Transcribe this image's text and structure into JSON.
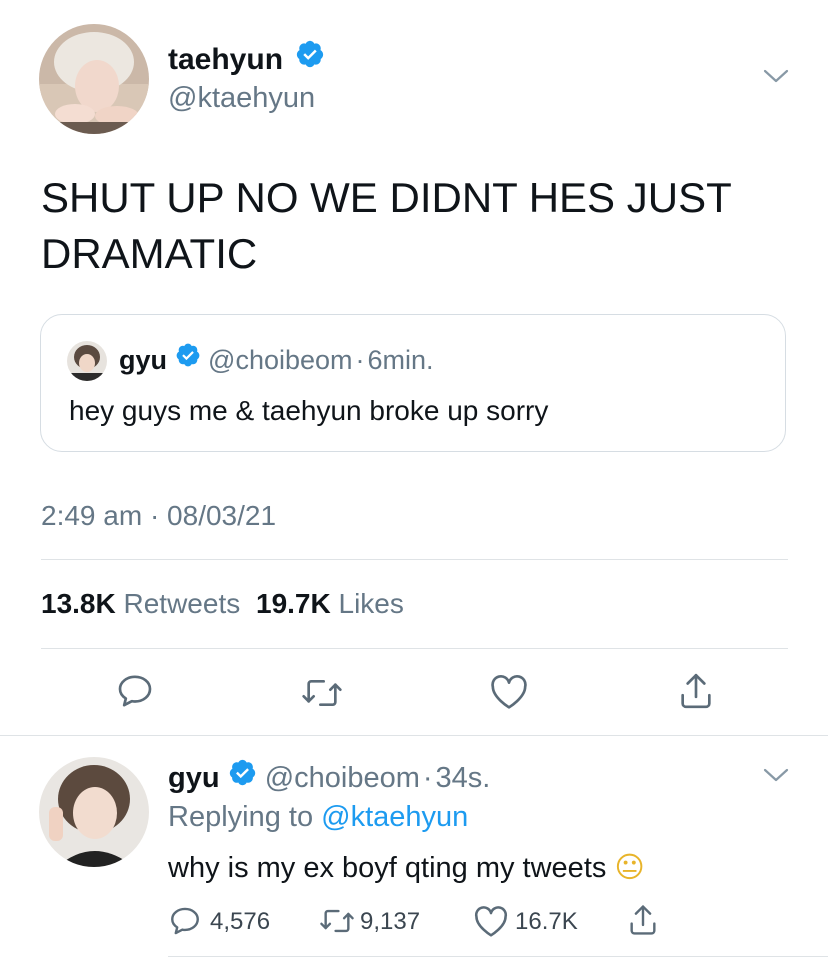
{
  "main_tweet": {
    "display_name": "taehyun",
    "handle": "@ktaehyun",
    "text_line1": "SHUT UP NO WE DIDNT HES JUST",
    "text_line2": "DRAMATIC",
    "quoted": {
      "display_name": "gyu",
      "handle": "@choibeom",
      "sep": "·",
      "time": "6min.",
      "text": "hey guys me & taehyun broke up sorry"
    },
    "timestamp": "2:49 am · 08/03/21",
    "retweets_count": "13.8K",
    "retweets_label": "Retweets",
    "likes_count": "19.7K",
    "likes_label": "Likes"
  },
  "reply": {
    "display_name": "gyu",
    "handle": "@choibeom",
    "sep": "·",
    "time": "34s.",
    "replying_to_label": "Replying to",
    "replying_to_handle": "@ktaehyun",
    "text": "why is my ex boyf qting my tweets",
    "emoji": "😐",
    "reply_count": "4,576",
    "retweet_count": "9,137",
    "like_count": "16.7K"
  },
  "colors": {
    "accent": "#1d9bf0",
    "secondary_text": "#657786",
    "divider": "#dfe3e6"
  },
  "icons": [
    "verified-badge-icon",
    "chevron-down-icon",
    "reply-icon",
    "retweet-icon",
    "like-icon",
    "share-icon"
  ]
}
